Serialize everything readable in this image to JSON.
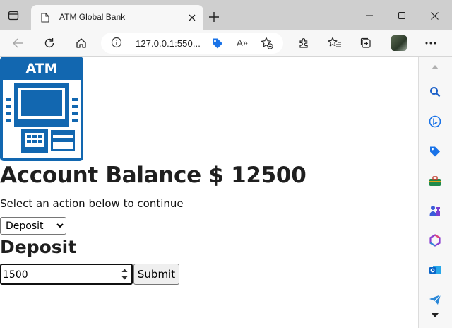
{
  "browser": {
    "tab_title": "ATM Global Bank",
    "url": "127.0.0.1:550...",
    "read_aloud_label": "A»"
  },
  "page": {
    "logo_text": "ATM",
    "balance_heading": "Account Balance $ 12500",
    "instruction": "Select an action below to continue",
    "action_select": {
      "selected": "Deposit",
      "options": [
        "Deposit"
      ]
    },
    "section_title": "Deposit",
    "amount_input": {
      "value": "1500"
    },
    "submit_label": "Submit"
  },
  "colors": {
    "atm_blue": "#1267b0",
    "tabbar": "#cfcfcf",
    "toolbar": "#f7f7f7"
  }
}
